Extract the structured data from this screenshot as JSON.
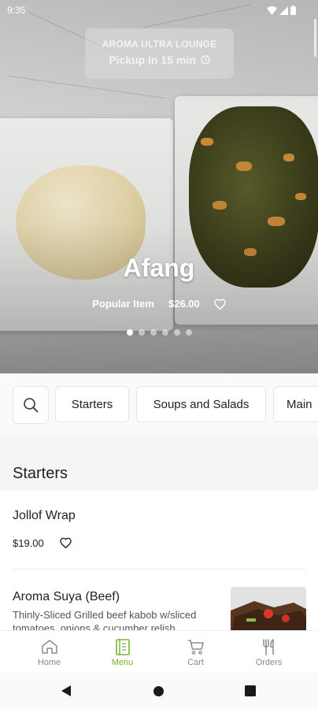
{
  "status_bar": {
    "time": "9:35"
  },
  "store": {
    "name": "AROMA ULTRA LOUNGE",
    "pickup": "Pickup in 15 min"
  },
  "featured": {
    "title": "Afang",
    "tag": "Popular Item",
    "price": "$26.00",
    "slide_count": 6,
    "active_slide": 1
  },
  "categories": [
    "Starters",
    "Soups and Salads",
    "Main"
  ],
  "section": {
    "title": "Starters"
  },
  "items": [
    {
      "name": "Jollof Wrap",
      "price": "$19.00"
    },
    {
      "name": "Aroma Suya (Beef)",
      "description": "Thinly-Sliced Grilled beef kabob w/sliced tomatoes, onions & cucumber relish"
    }
  ],
  "bottom_nav": [
    {
      "label": "Home",
      "icon": "home-icon"
    },
    {
      "label": "Menu",
      "icon": "menu-book-icon",
      "active": true
    },
    {
      "label": "Cart",
      "icon": "cart-icon"
    },
    {
      "label": "Orders",
      "icon": "fork-knife-icon"
    }
  ],
  "colors": {
    "accent": "#7bb32e"
  }
}
